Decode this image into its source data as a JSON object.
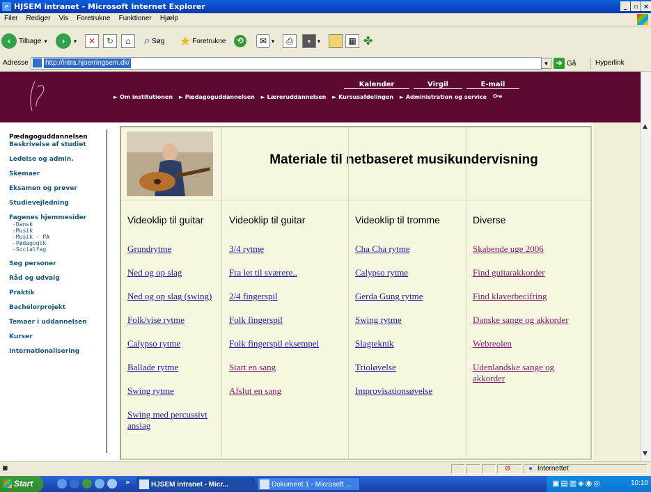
{
  "window": {
    "title": "HJSEM intranet - Microsoft Internet Explorer"
  },
  "menu": [
    "Filer",
    "Rediger",
    "Vis",
    "Foretrukne",
    "Funktioner",
    "Hjælp"
  ],
  "toolbar": {
    "back": "Tilbage",
    "search": "Søg",
    "favorites": "Foretrukne"
  },
  "address": {
    "label": "Adresse",
    "url": "http://intra.hjoerringsem.dk/",
    "go": "Gå",
    "links": "Hyperlink"
  },
  "site": {
    "top_links": [
      "Kalender",
      "Virgil",
      "E-mail"
    ],
    "main_nav": [
      "Om institutionen",
      "Pædagoguddannelsen",
      "Læreruddannelsen",
      "Kursusafdelingen",
      "Administration og service"
    ],
    "left_nav": {
      "heading": "Pædagoguddannelsen",
      "items_a": [
        "Beskrivelse af studiet",
        "Ledelse og admin.",
        "Skemaer",
        "Eksamen og prøver",
        "Studievejledning",
        "Fagenes hjemmesider"
      ],
      "sub": [
        "-Dansk",
        "-Musik",
        "-Musik - PA",
        "-Pædagogik",
        "-Socialfag"
      ],
      "items_b": [
        "Søg personer",
        "Råd og udvalg",
        "Praktik",
        "Bachelorprojekt",
        "Temaer i uddannelsen",
        "Kurser",
        "Internationalisering"
      ]
    }
  },
  "content": {
    "title": "Materiale til netbaseret musikundervisning",
    "columns": [
      {
        "heading": "Videoklip til guitar",
        "links": [
          "Grundrytme",
          "Ned og op slag",
          "Ned og op slag (swing)",
          "Folk/vise rytme",
          "Calypso rytme",
          "Ballade rytme",
          "Swing rytme",
          "Swing med percussivt anslag"
        ]
      },
      {
        "heading": "Videoklip til guitar",
        "links": [
          "3/4 rytme",
          "Fra let til sværere..",
          "2/4 fingerspil",
          "Folk fingerspil",
          "Folk fingerspil eksempel",
          "Start en sang",
          "Afslut en sang"
        ]
      },
      {
        "heading": "Videoklip til tromme",
        "links": [
          "Cha Cha rytme",
          "Calypso rytme",
          "Gerda Gung rytme",
          "Swing rytme",
          "Slagteknik",
          "Trioløvelse",
          "Improvisationsøvelse"
        ]
      },
      {
        "heading": "Diverse",
        "links": [
          "Skabende uge 2006",
          "Find guitarakkorder",
          "Find klaverbecifring",
          "Danske sange og akkorder",
          "Webreolen",
          "Udenlandske sange og akkorder"
        ]
      }
    ]
  },
  "status": {
    "zone": "Internettet"
  },
  "taskbar": {
    "start": "Start",
    "items": [
      "HJSEM intranet - Micr...",
      "Dokument 1 - Microsoft ..."
    ],
    "clock": "10:10"
  },
  "colors": {
    "banner": "#5c0a30",
    "content_bg": "#f7f6df",
    "link": "#1a1aa8",
    "visited": "#7a1a6a"
  }
}
